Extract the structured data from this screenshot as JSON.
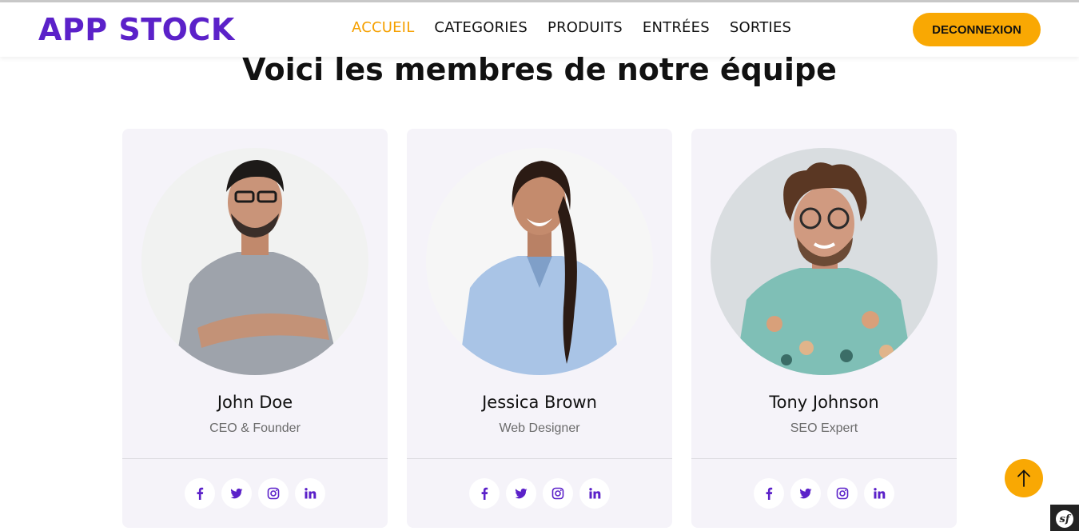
{
  "brand": {
    "logo_text": "APP STOCK",
    "accent": "#5b21c9",
    "highlight": "#f9a803"
  },
  "nav": {
    "items": [
      {
        "label": "ACCUEIL",
        "active": true
      },
      {
        "label": "CATEGORIES",
        "active": false
      },
      {
        "label": "PRODUITS",
        "active": false
      },
      {
        "label": "ENTRÉES",
        "active": false
      },
      {
        "label": "SORTIES",
        "active": false
      }
    ],
    "logout_label": "DECONNEXION"
  },
  "team": {
    "title": "Voici les membres de notre équipe",
    "members": [
      {
        "name": "John Doe",
        "role": "CEO & Founder"
      },
      {
        "name": "Jessica Brown",
        "role": "Web Designer"
      },
      {
        "name": "Tony Johnson",
        "role": "SEO Expert"
      }
    ],
    "social_icons": [
      "facebook-icon",
      "twitter-icon",
      "instagram-icon",
      "linkedin-icon"
    ]
  },
  "scroll_top": {
    "icon": "arrow-up-icon"
  },
  "debug_toolbar": {
    "icon": "symfony-icon"
  }
}
